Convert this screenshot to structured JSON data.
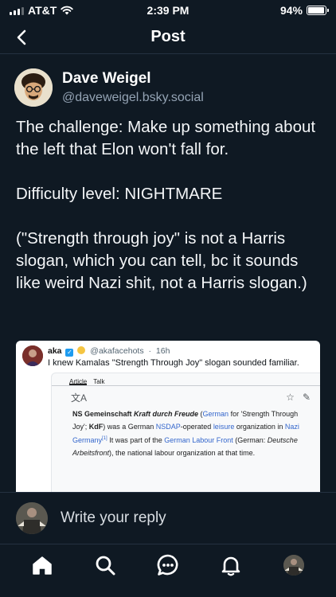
{
  "status_bar": {
    "carrier": "AT&T",
    "time": "2:39 PM",
    "battery_percent": "94%",
    "battery_level": 0.94,
    "signal_bars": 3
  },
  "header": {
    "title": "Post",
    "back_icon": "chevron-left-icon"
  },
  "post": {
    "author_name": "Dave Weigel",
    "author_handle": "@daveweigel.bsky.social",
    "paragraphs": [
      "The challenge: Make up something about the left that Elon won't fall for.",
      "Difficulty level: NIGHTMARE",
      "(\"Strength through joy\" is not a Harris slogan, which you can tell, bc it sounds like weird Nazi shit, not a Harris slogan.)"
    ]
  },
  "embed": {
    "name": "aka",
    "handle": "@akafacehots",
    "time": "16h",
    "separator": "·",
    "text": "I knew Kamalas \"Strength Through Joy\" slogan sounded familiar.",
    "wiki": {
      "tab_article": "Article",
      "tab_talk": "Talk",
      "lead_bold": "NS Gemeinschaft ",
      "lead_bold_italic": "Kraft durch Freude",
      "open_paren": " (",
      "link_german": "German",
      "for_text": " for 'Strength Through Joy'; ",
      "kdf": "KdF",
      "was_a_german": ") was a German ",
      "link_nsdap": "NSDAP",
      "operated": "-operated ",
      "link_leisure": "leisure",
      "org_in": " organization in ",
      "link_nazi_germany": "Nazi Germany",
      "footnote": "[1]",
      "it_was_part": " It was part of the ",
      "link_labour_front": "German Labour Front",
      "german_paren": " (German: ",
      "deutsche": "Deutsche Arbeitsfront",
      "tail": "), the national labour organization at that time."
    }
  },
  "reply": {
    "placeholder": "Write your reply"
  },
  "tabbar": {
    "items": [
      "home-icon",
      "search-icon",
      "chat-icon",
      "bell-icon",
      "profile-avatar"
    ]
  }
}
